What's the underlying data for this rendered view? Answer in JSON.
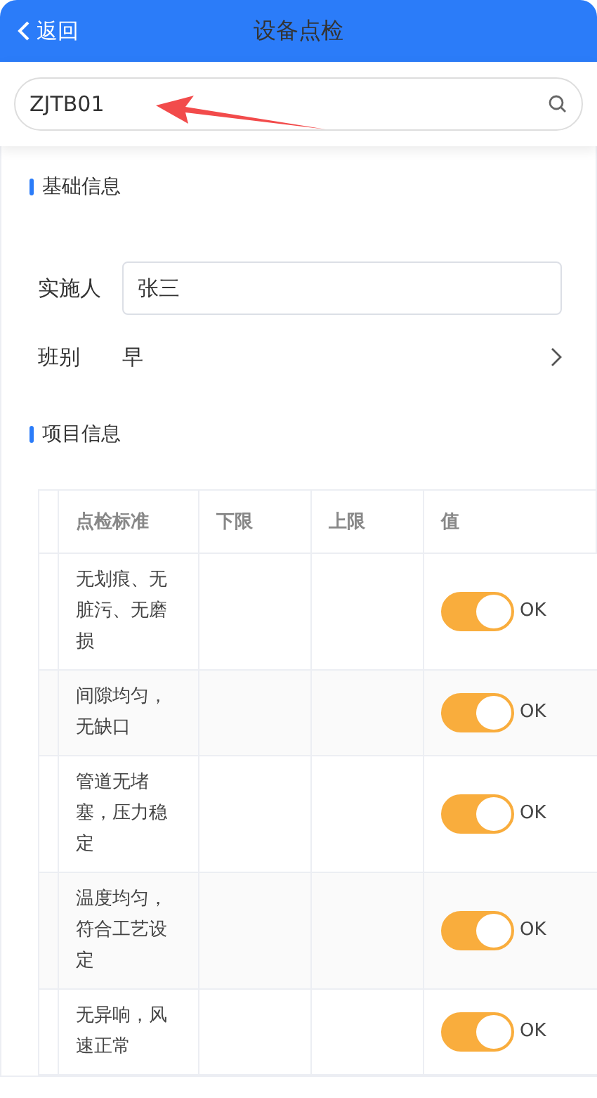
{
  "header": {
    "back_label": "返回",
    "title": "设备点检"
  },
  "search": {
    "value": "ZJTB01"
  },
  "basic_info": {
    "title": "基础信息",
    "fields": [
      {
        "kind": "input",
        "label": "实施人",
        "value": "张三"
      },
      {
        "kind": "select",
        "label": "班别",
        "value": "早"
      }
    ]
  },
  "project_info": {
    "title": "项目信息",
    "columns": [
      "点检标准",
      "下限",
      "上限",
      "值"
    ],
    "rows": [
      {
        "standard": "无划痕、无脏污、无磨损",
        "lower": "",
        "upper": "",
        "on": true,
        "value_label": "OK"
      },
      {
        "standard": "间隙均匀，无缺口",
        "lower": "",
        "upper": "",
        "on": true,
        "value_label": "OK"
      },
      {
        "standard": "管道无堵塞，压力稳定",
        "lower": "",
        "upper": "",
        "on": true,
        "value_label": "OK"
      },
      {
        "standard": "温度均匀，符合工艺设定",
        "lower": "",
        "upper": "",
        "on": true,
        "value_label": "OK"
      },
      {
        "standard": "无异响，风速正常",
        "lower": "",
        "upper": "",
        "on": true,
        "value_label": "OK"
      }
    ]
  }
}
